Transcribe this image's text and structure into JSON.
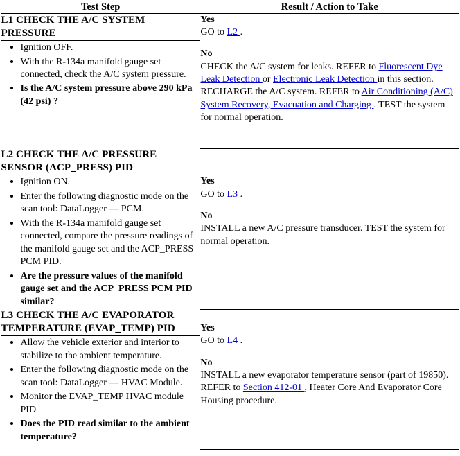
{
  "table": {
    "headers": {
      "test_step": "Test Step",
      "result_action": "Result / Action to Take"
    },
    "steps": [
      {
        "id": "L1",
        "title": "L1 CHECK THE A/C SYSTEM PRESSURE",
        "bullets": [
          {
            "text": "Ignition OFF.",
            "bold": false
          },
          {
            "text": "With the R-134a manifold gauge set connected, check the A/C system pressure.",
            "bold": false
          },
          {
            "text": "Is the A/C system pressure above 290 kPa (42 psi) ?",
            "bold": true
          }
        ],
        "result": {
          "yes_label": "Yes",
          "yes_parts": [
            {
              "type": "text",
              "text": "GO to "
            },
            {
              "type": "link",
              "text": "L2 "
            },
            {
              "type": "text",
              "text": "."
            }
          ],
          "no_label": "No",
          "no_parts": [
            {
              "type": "text",
              "text": "CHECK the A/C system for leaks. REFER to "
            },
            {
              "type": "link",
              "text": "Fluorescent Dye Leak Detection "
            },
            {
              "type": "text",
              "text": "or "
            },
            {
              "type": "link",
              "text": "Electronic Leak Detection "
            },
            {
              "type": "text",
              "text": "in this section. RECHARGE the A/C system. REFER to "
            },
            {
              "type": "link",
              "text": "Air Conditioning (A/C) System Recovery, Evacuation and Charging "
            },
            {
              "type": "text",
              "text": ". TEST the system for normal operation."
            }
          ]
        }
      },
      {
        "id": "L2",
        "title": "L2 CHECK THE A/C PRESSURE SENSOR (ACP_PRESS) PID",
        "bullets": [
          {
            "text": "Ignition ON.",
            "bold": false
          },
          {
            "text": "Enter the following diagnostic mode on the scan tool: DataLogger — PCM.",
            "bold": false
          },
          {
            "text": "With the R-134a manifold gauge set connected, compare the pressure readings of the manifold gauge set and the ACP_PRESS PCM PID.",
            "bold": false
          },
          {
            "text": "Are the pressure values of the manifold gauge set and the ACP_PRESS PCM PID similar?",
            "bold": true
          }
        ],
        "result": {
          "yes_label": "Yes",
          "yes_parts": [
            {
              "type": "text",
              "text": "GO to "
            },
            {
              "type": "link",
              "text": "L3 "
            },
            {
              "type": "text",
              "text": "."
            }
          ],
          "no_label": "No",
          "no_parts": [
            {
              "type": "text",
              "text": "INSTALL a new A/C pressure transducer. TEST the system for normal operation."
            }
          ]
        }
      },
      {
        "id": "L3",
        "title": "L3 CHECK THE A/C EVAPORATOR TEMPERATURE (EVAP_TEMP) PID",
        "bullets": [
          {
            "text": "Allow the vehicle exterior and interior to stabilize to the ambient temperature.",
            "bold": false
          },
          {
            "text": "Enter the following diagnostic mode on the scan tool: DataLogger — HVAC Module.",
            "bold": false
          },
          {
            "text": "Monitor the EVAP_TEMP HVAC module PID",
            "bold": false
          },
          {
            "text": "Does the PID read similar to the ambient temperature?",
            "bold": true
          }
        ],
        "result": {
          "yes_label": "Yes",
          "yes_parts": [
            {
              "type": "text",
              "text": "GO to "
            },
            {
              "type": "link",
              "text": "L4 "
            },
            {
              "type": "text",
              "text": "."
            }
          ],
          "no_label": "No",
          "no_parts": [
            {
              "type": "text",
              "text": "INSTALL a new evaporator temperature sensor (part of 19850). REFER to "
            },
            {
              "type": "link",
              "text": "Section 412-01 "
            },
            {
              "type": "text",
              "text": ", Heater Core And Evaporator Core Housing procedure."
            }
          ]
        }
      }
    ]
  },
  "colors": {
    "link": "#0000cc",
    "border": "#000000",
    "text": "#000000",
    "background": "#ffffff"
  }
}
